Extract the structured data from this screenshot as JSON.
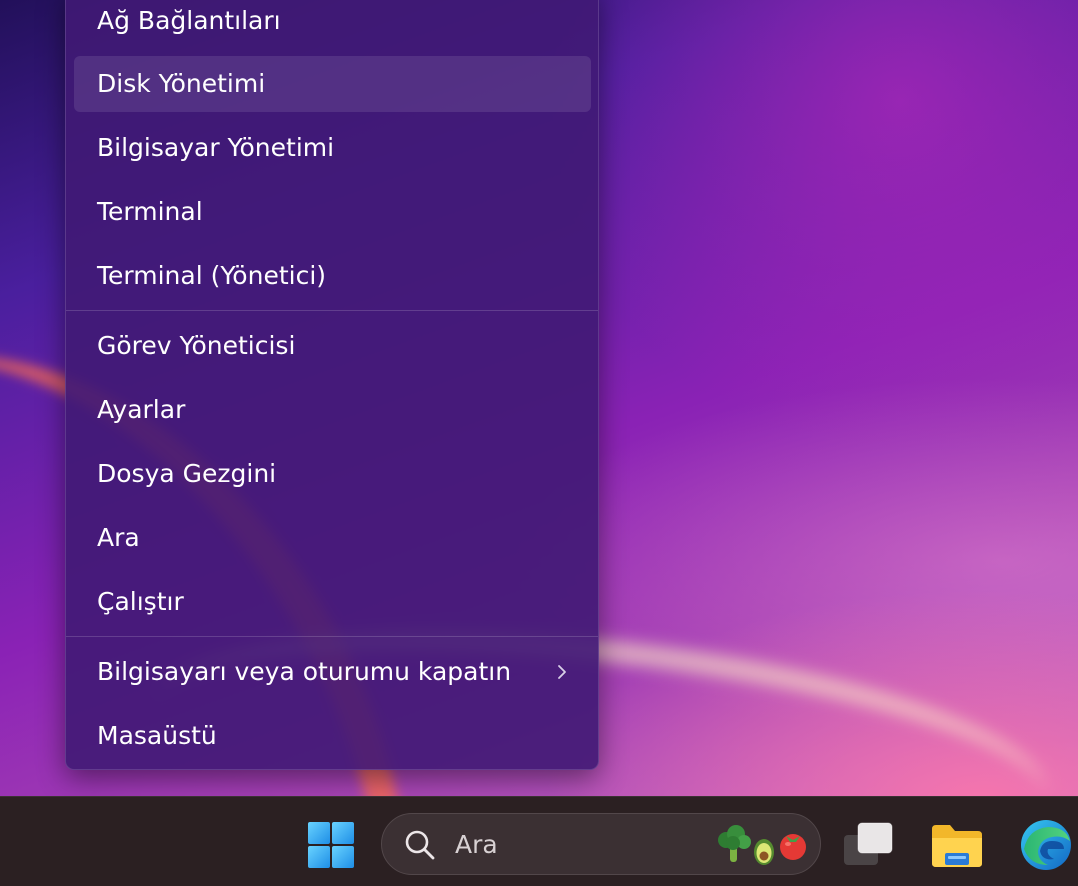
{
  "context_menu": {
    "items": [
      {
        "label": "Ağ Bağlantıları"
      },
      {
        "label": "Disk Yönetimi"
      },
      {
        "label": "Bilgisayar Yönetimi"
      },
      {
        "label": "Terminal"
      },
      {
        "label": "Terminal (Yönetici)"
      },
      {
        "label": "Görev Yöneticisi"
      },
      {
        "label": "Ayarlar"
      },
      {
        "label": "Dosya Gezgini"
      },
      {
        "label": "Ara"
      },
      {
        "label": "Çalıştır"
      },
      {
        "label": "Bilgisayarı veya oturumu kapatın"
      },
      {
        "label": "Masaüstü"
      }
    ],
    "highlighted_item": "Disk Yönetimi"
  },
  "taskbar": {
    "search": {
      "placeholder": "Ara"
    },
    "icons": [
      "start-icon",
      "search-icon",
      "search-highlight-icon",
      "task-view-icon",
      "file-explorer-icon",
      "edge-icon"
    ]
  },
  "colors": {
    "menu_background": "#401a74",
    "taskbar_background": "#2b2022",
    "menu_text": "#ffffff",
    "start_blue": "#4cc2ff"
  }
}
